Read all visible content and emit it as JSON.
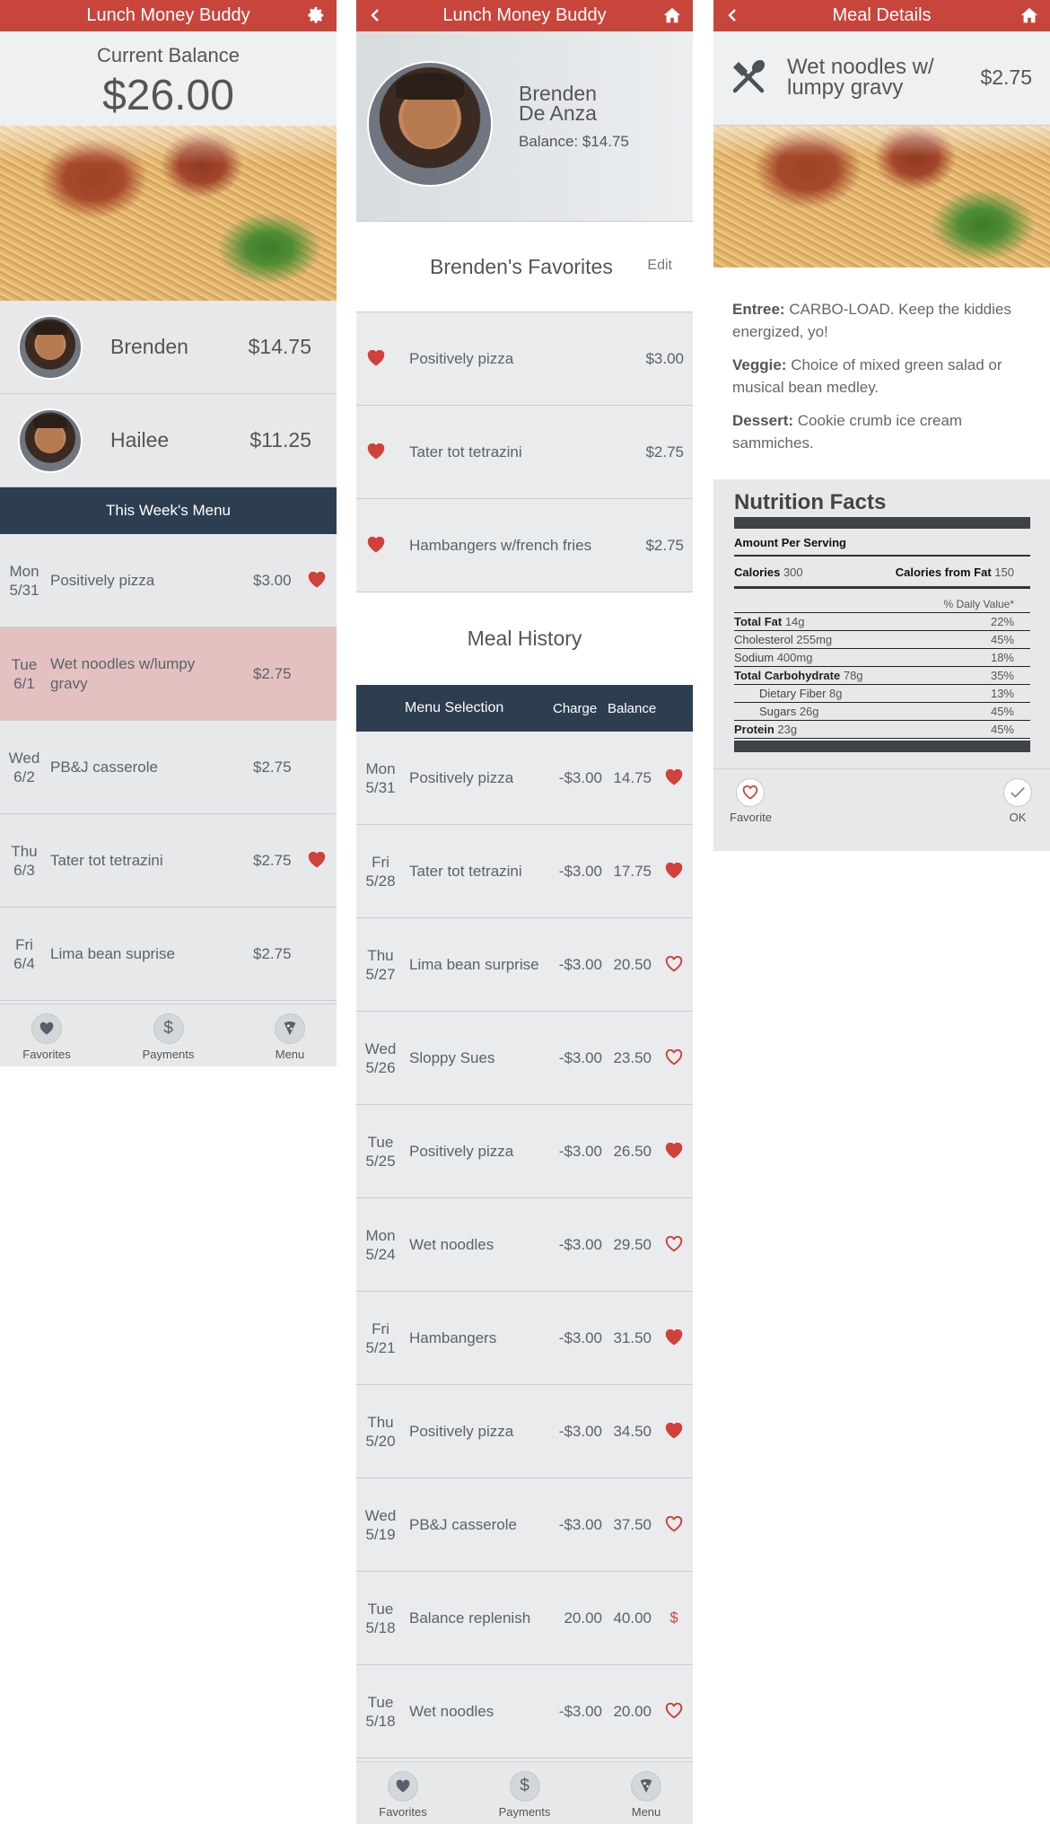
{
  "colors": {
    "header_red": "#c8453b",
    "dark_navy": "#2d3e50",
    "heart_red": "#d0413a",
    "highlight_row": "#e3c1c0",
    "panel_gray": "#e6e8ea"
  },
  "screen1": {
    "title": "Lunch Money Buddy",
    "balance_label": "Current Balance",
    "balance_value": "$26.00",
    "kids": [
      {
        "name": "Brenden",
        "amount": "$14.75"
      },
      {
        "name": "Hailee",
        "amount": "$11.25"
      }
    ],
    "menu_header": "This Week's Menu",
    "menu": [
      {
        "day": "Mon",
        "date": "5/31",
        "name": "Positively pizza",
        "price": "$3.00",
        "favorite": true,
        "highlight": false
      },
      {
        "day": "Tue",
        "date": "6/1",
        "name": "Wet noodles w/lumpy gravy",
        "price": "$2.75",
        "favorite": false,
        "highlight": true
      },
      {
        "day": "Wed",
        "date": "6/2",
        "name": "PB&J casserole",
        "price": "$2.75",
        "favorite": false,
        "highlight": false
      },
      {
        "day": "Thu",
        "date": "6/3",
        "name": "Tater tot tetrazini",
        "price": "$2.75",
        "favorite": true,
        "highlight": false
      },
      {
        "day": "Fri",
        "date": "6/4",
        "name": "Lima bean suprise",
        "price": "$2.75",
        "favorite": false,
        "highlight": false
      }
    ],
    "nav": [
      "Favorites",
      "Payments",
      "Menu"
    ]
  },
  "screen2": {
    "title": "Lunch Money Buddy",
    "first_name": "Brenden",
    "last_name": "De Anza",
    "balance": "Balance: $14.75",
    "favorites_title": "Brenden's Favorites",
    "edit": "Edit",
    "favorites": [
      {
        "name": "Positively pizza",
        "price": "$3.00"
      },
      {
        "name": "Tater tot tetrazini",
        "price": "$2.75"
      },
      {
        "name": "Hambangers w/french fries",
        "price": "$2.75"
      }
    ],
    "history_title": "Meal History",
    "history_headers": {
      "selection": "Menu Selection",
      "charge": "Charge",
      "balance": "Balance"
    },
    "history": [
      {
        "day": "Mon",
        "date": "5/31",
        "name": "Positively pizza",
        "charge": "-$3.00",
        "balance": "14.75",
        "icon": "heart-filled"
      },
      {
        "day": "Fri",
        "date": "5/28",
        "name": "Tater tot tetrazini",
        "charge": "-$3.00",
        "balance": "17.75",
        "icon": "heart-filled"
      },
      {
        "day": "Thu",
        "date": "5/27",
        "name": "Lima bean surprise",
        "charge": "-$3.00",
        "balance": "20.50",
        "icon": "heart-outline"
      },
      {
        "day": "Wed",
        "date": "5/26",
        "name": "Sloppy Sues",
        "charge": "-$3.00",
        "balance": "23.50",
        "icon": "heart-outline"
      },
      {
        "day": "Tue",
        "date": "5/25",
        "name": "Positively pizza",
        "charge": "-$3.00",
        "balance": "26.50",
        "icon": "heart-filled"
      },
      {
        "day": "Mon",
        "date": "5/24",
        "name": "Wet noodles",
        "charge": "-$3.00",
        "balance": "29.50",
        "icon": "heart-outline"
      },
      {
        "day": "Fri",
        "date": "5/21",
        "name": "Hambangers",
        "charge": "-$3.00",
        "balance": "31.50",
        "icon": "heart-filled"
      },
      {
        "day": "Thu",
        "date": "5/20",
        "name": "Positively pizza",
        "charge": "-$3.00",
        "balance": "34.50",
        "icon": "heart-filled"
      },
      {
        "day": "Wed",
        "date": "5/19",
        "name": "PB&J casserole",
        "charge": "-$3.00",
        "balance": "37.50",
        "icon": "heart-outline"
      },
      {
        "day": "Tue",
        "date": "5/18",
        "name": "Balance replenish",
        "charge": "20.00",
        "balance": "40.00",
        "icon": "dollar"
      },
      {
        "day": "Tue",
        "date": "5/18",
        "name": "Wet noodles",
        "charge": "-$3.00",
        "balance": "20.00",
        "icon": "heart-outline"
      }
    ],
    "nav": [
      "Favorites",
      "Payments",
      "Menu"
    ]
  },
  "screen3": {
    "title": "Meal Details",
    "meal_name": "Wet noodles w/ lumpy gravy",
    "price": "$2.75",
    "entree_label": "Entree:",
    "entree_text": "CARBO-LOAD. Keep the kiddies energized, yo!",
    "veggie_label": "Veggie:",
    "veggie_text": "Choice of mixed green salad or musical bean medley.",
    "dessert_label": "Dessert:",
    "dessert_text": "Cookie crumb ice cream sammiches.",
    "nutrition": {
      "title": "Nutrition Facts",
      "amount_per_serving": "Amount Per Serving",
      "calories_label": "Calories",
      "calories_value": "300",
      "fat_cal_label": "Calories from Fat",
      "fat_cal_value": "150",
      "dv_header": "% Daily Value*",
      "rows": [
        {
          "label": "Total Fat",
          "amount": "14g",
          "dv": "22%",
          "bold": true,
          "indent": false
        },
        {
          "label": "Cholesterol",
          "amount": "255mg",
          "dv": "45%",
          "bold": false,
          "indent": false
        },
        {
          "label": "Sodium",
          "amount": "400mg",
          "dv": "18%",
          "bold": false,
          "indent": false
        },
        {
          "label": "Total Carbohydrate",
          "amount": "78g",
          "dv": "35%",
          "bold": true,
          "indent": false
        },
        {
          "label": "Dietary Fiber",
          "amount": "8g",
          "dv": "13%",
          "bold": false,
          "indent": true
        },
        {
          "label": "Sugars",
          "amount": "26g",
          "dv": "45%",
          "bold": false,
          "indent": true
        },
        {
          "label": "Protein",
          "amount": "23g",
          "dv": "45%",
          "bold": true,
          "indent": false
        }
      ]
    },
    "favorite_label": "Favorite",
    "ok_label": "OK"
  }
}
